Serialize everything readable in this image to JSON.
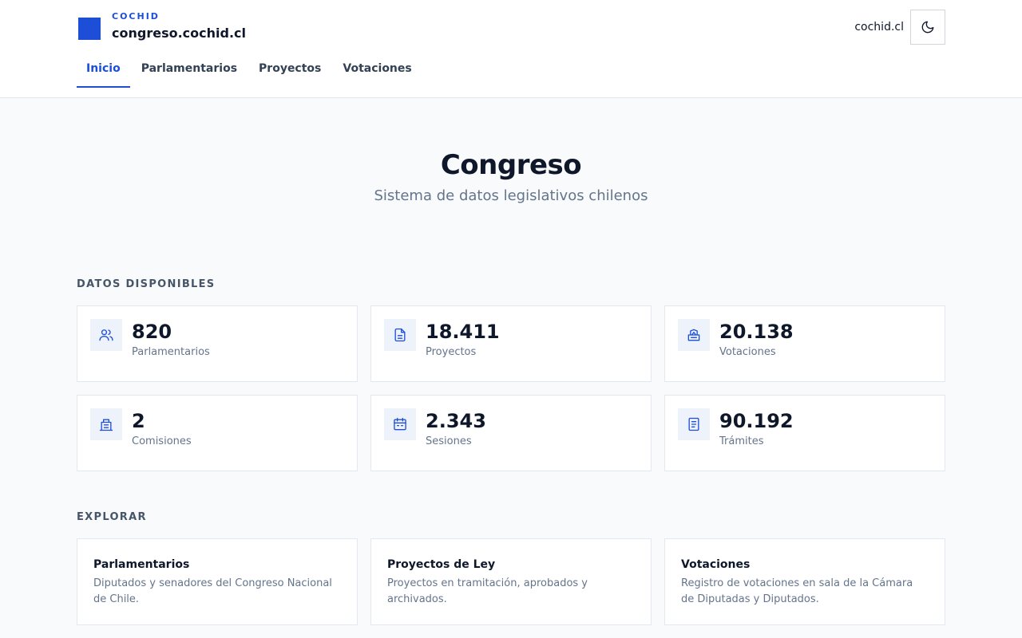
{
  "brand": {
    "kicker": "COCHID",
    "domain": "congreso.cochid.cl"
  },
  "header": {
    "external_link": "cochid.cl",
    "theme_icon": "moon-icon"
  },
  "nav": [
    {
      "label": "Inicio",
      "active": true
    },
    {
      "label": "Parlamentarios",
      "active": false
    },
    {
      "label": "Proyectos",
      "active": false
    },
    {
      "label": "Votaciones",
      "active": false
    }
  ],
  "hero": {
    "title": "Congreso",
    "subtitle": "Sistema de datos legislativos chilenos"
  },
  "stats_section": {
    "title": "DATOS DISPONIBLES",
    "items": [
      {
        "value": "820",
        "label": "Parlamentarios",
        "icon": "users-icon"
      },
      {
        "value": "18.411",
        "label": "Proyectos",
        "icon": "document-icon"
      },
      {
        "value": "20.138",
        "label": "Votaciones",
        "icon": "ballot-box-icon"
      },
      {
        "value": "2",
        "label": "Comisiones",
        "icon": "building-icon"
      },
      {
        "value": "2.343",
        "label": "Sesiones",
        "icon": "calendar-icon"
      },
      {
        "value": "90.192",
        "label": "Trámites",
        "icon": "clipboard-icon"
      }
    ]
  },
  "explore_section": {
    "title": "EXPLORAR",
    "cards": [
      {
        "title": "Parlamentarios",
        "description": "Diputados y senadores del Congreso Nacional de Chile."
      },
      {
        "title": "Proyectos de Ley",
        "description": "Proyectos en tramitación, aprobados y archivados."
      },
      {
        "title": "Votaciones",
        "description": "Registro de votaciones en sala de la Cámara de Diputadas y Diputados."
      }
    ]
  },
  "colors": {
    "accent": "#1d4ed8",
    "text": "#0f172a",
    "muted": "#64748b",
    "background": "#f8fafc",
    "border": "#e2e8f0"
  }
}
